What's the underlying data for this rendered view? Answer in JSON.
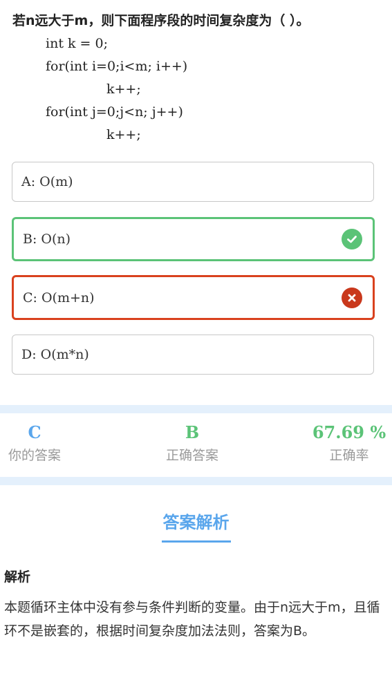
{
  "question": {
    "text": "若n远大于m，则下面程序段的时间复杂度为（ ）。",
    "code_lines": [
      "int k = 0;",
      "for(int i=0;i<m; i++)",
      "k++;",
      "for(int j=0;j<n; j++)",
      "k++;"
    ]
  },
  "options": [
    {
      "label": "A: O(m)",
      "state": "normal"
    },
    {
      "label": "B: O(n)",
      "state": "correct",
      "icon": "check-circle-icon"
    },
    {
      "label": "C: O(m+n)",
      "state": "wrong",
      "icon": "x-circle-icon"
    },
    {
      "label": "D: O(m*n)",
      "state": "normal"
    }
  ],
  "stats": {
    "your_answer": {
      "value": "C",
      "label": "你的答案",
      "color": "#5aa6ec"
    },
    "correct_answer": {
      "value": "B",
      "label": "正确答案",
      "color": "#5bc377"
    },
    "accuracy": {
      "value": "67.69 %",
      "label": "正确率",
      "color": "#5bc377"
    }
  },
  "analysis": {
    "title": "答案解析",
    "heading": "解析",
    "body": "本题循环主体中没有参与条件判断的变量。由于n远大于m，且循环不是嵌套的，根据时间复杂度加法法则，答案为B。"
  },
  "colors": {
    "correct": "#5bc377",
    "wrong": "#d9411e",
    "accent": "#5aa6ec",
    "band": "#e4f0fc"
  }
}
